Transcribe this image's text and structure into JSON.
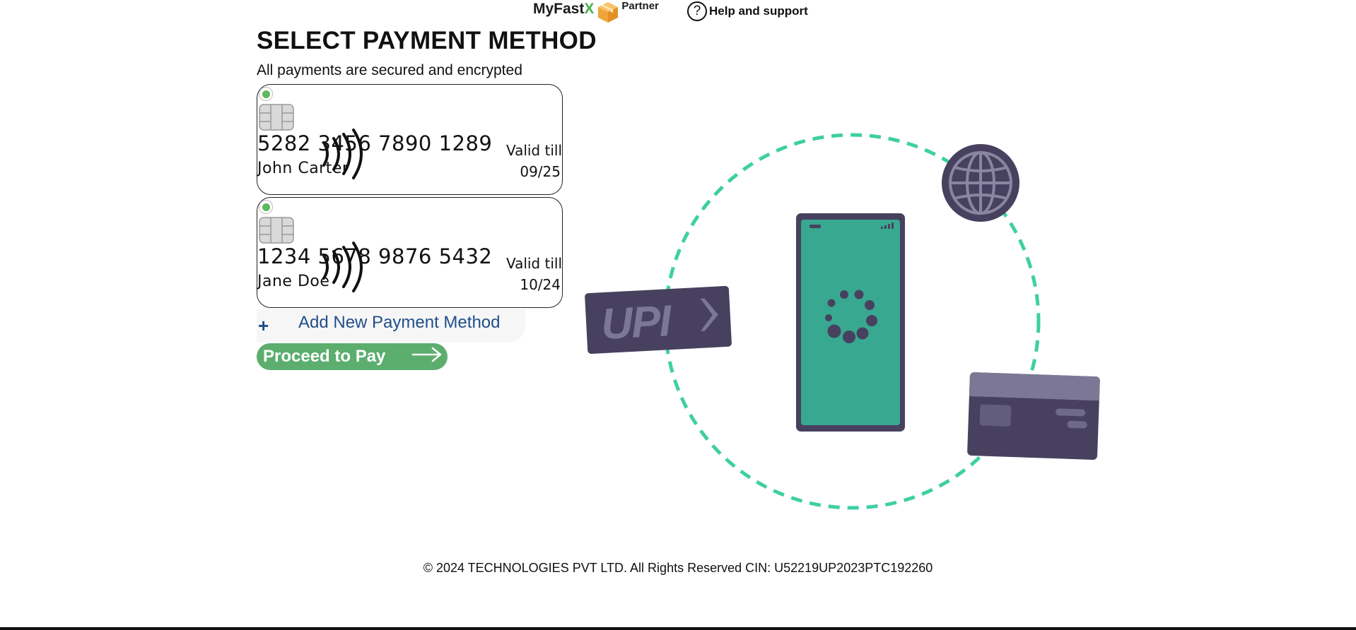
{
  "header": {
    "brand_name": "MyFast",
    "brand_accent": "X",
    "brand_suffix": "Partner",
    "help_label": "Help and support",
    "help_icon": "question-circle-icon"
  },
  "page": {
    "title": "SELECT PAYMENT METHOD",
    "subtitle": "All payments are secured and encrypted"
  },
  "cards": [
    {
      "number": "5282 3456 7890 1289",
      "holder": "John Carter",
      "valid_label": "Valid till",
      "valid_date": "09/25",
      "selected": true
    },
    {
      "number": "1234 5678 9876 5432",
      "holder": "Jane Doe",
      "valid_label": "Valid till",
      "valid_date": "10/24",
      "selected": false
    }
  ],
  "actions": {
    "add_plus": "+",
    "add_new_label": "Add New Payment Method",
    "proceed_label": "Proceed to Pay"
  },
  "illustration": {
    "upi_label": "UPI",
    "icons": [
      "globe-icon",
      "phone-icon",
      "credit-card-icon",
      "upi-badge-icon"
    ]
  },
  "footer": {
    "copyright": "© 2024 TECHNOLOGIES PVT LTD. All Rights Reserved CIN: U52219UP2023PTC192260"
  },
  "colors": {
    "accent_green": "#5cae6e",
    "link_blue": "#1f4e8c",
    "teal": "#38a891",
    "dashed_circle": "#3ecfa3",
    "navy_purple": "#47415f"
  }
}
